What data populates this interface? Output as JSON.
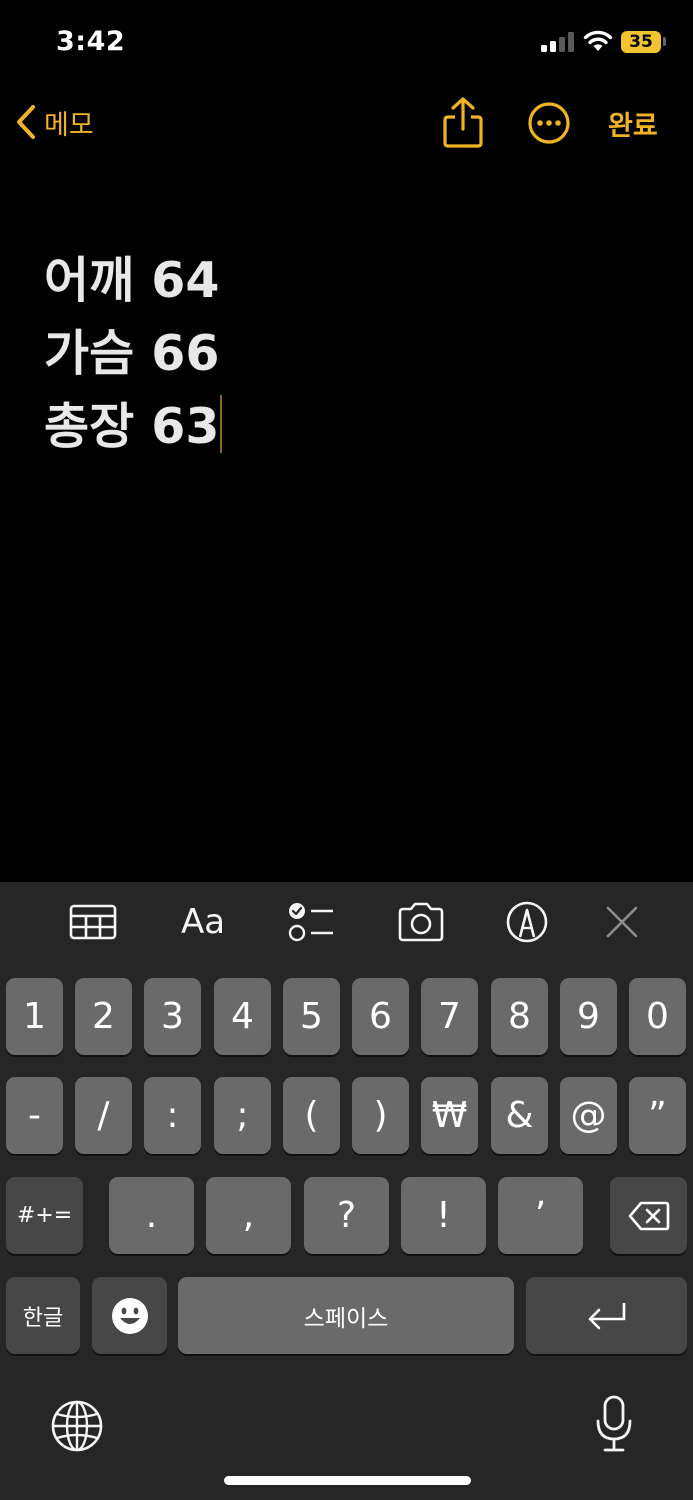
{
  "status": {
    "time": "3:42",
    "battery": "35"
  },
  "nav": {
    "back_label": "메모",
    "done_label": "완료"
  },
  "note": {
    "lines": [
      "어깨 64",
      "가슴 66",
      "총장 63"
    ]
  },
  "toolbar": {
    "format_label": "Aa"
  },
  "keyboard": {
    "row1": [
      "1",
      "2",
      "3",
      "4",
      "5",
      "6",
      "7",
      "8",
      "9",
      "0"
    ],
    "row2": [
      "-",
      "/",
      ":",
      ";",
      "(",
      ")",
      "₩",
      "&",
      "@",
      "”"
    ],
    "row3_mode": "#+=",
    "row3": [
      ".",
      ",",
      "?",
      "!",
      "’"
    ],
    "lang_label": "한글",
    "space_label": "스페이스"
  },
  "colors": {
    "accent": "#f0b323",
    "background": "#000000",
    "keyboard": "#262626",
    "key": "#6a6a6a",
    "key_dark": "#474747"
  }
}
